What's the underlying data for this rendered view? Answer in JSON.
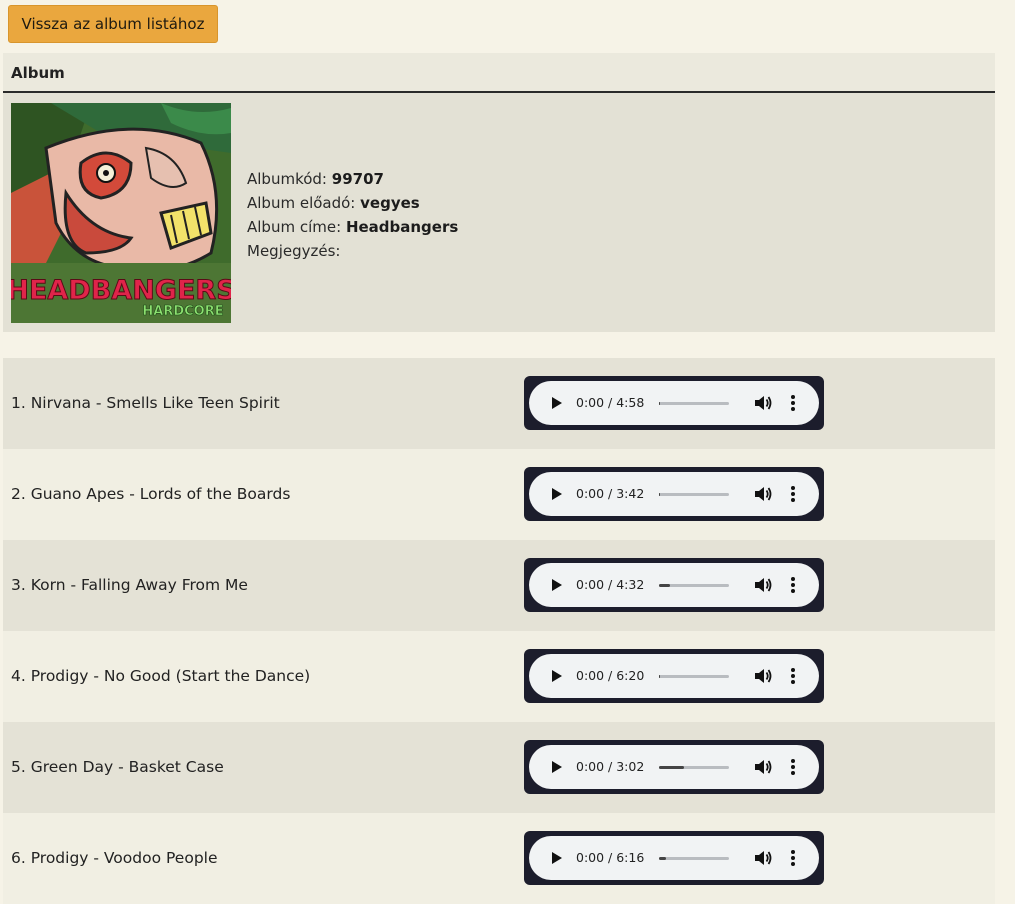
{
  "back_button": {
    "label": "Vissza az album listához"
  },
  "album": {
    "header": "Album",
    "code_label": "Albumkód:",
    "code_value": "99707",
    "artist_label": "Album előadó:",
    "artist_value": "vegyes",
    "title_label": "Album címe:",
    "title_value": "Headbangers",
    "note_label": "Megjegyzés:",
    "note_value": "",
    "cover": {
      "title_text": "HEADBANGERS",
      "subtitle_text": "HARDCORE"
    }
  },
  "tracks": [
    {
      "title": "1. Nirvana - Smells Like Teen Spirit",
      "time": "0:00 / 4:58",
      "buffered": 0.02
    },
    {
      "title": "2. Guano Apes - Lords of the Boards",
      "time": "0:00 / 3:42",
      "buffered": 0.02
    },
    {
      "title": "3. Korn - Falling Away From Me",
      "time": "0:00 / 4:32",
      "buffered": 0.15
    },
    {
      "title": "4. Prodigy - No Good (Start the Dance)",
      "time": "0:00 / 6:20",
      "buffered": 0.02
    },
    {
      "title": "5. Green Day - Basket Case",
      "time": "0:00 / 3:02",
      "buffered": 0.35
    },
    {
      "title": "6. Prodigy - Voodoo People",
      "time": "0:00 / 6:16",
      "buffered": 0.1
    }
  ],
  "colors": {
    "accent": "#eaa73e",
    "background": "#f6f3e7",
    "row_odd": "#e4e2d6",
    "row_even": "#f1efe3",
    "player_frame": "#1c1d2c"
  },
  "icons": {
    "play": "play-icon",
    "volume": "volume-icon",
    "more": "more-options-icon"
  }
}
